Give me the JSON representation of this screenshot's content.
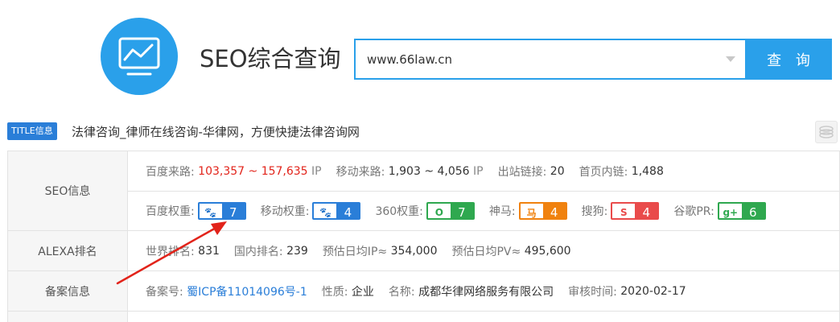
{
  "header": {
    "title": "SEO综合查询",
    "search_value": "www.66law.cn",
    "search_button": "查 询"
  },
  "title_row": {
    "badge": "TITLE信息",
    "text": "法律咨询_律师在线咨询-华律网，方便快捷法律咨询网"
  },
  "seo": {
    "label": "SEO信息",
    "baidu_traffic_label": "百度来路:",
    "baidu_traffic_value": "103,357 ~ 157,635",
    "baidu_traffic_unit": "IP",
    "mobile_traffic_label": "移动来路:",
    "mobile_traffic_value": "1,903 ~ 4,056",
    "mobile_traffic_unit": "IP",
    "outlinks_label": "出站链接:",
    "outlinks_value": "20",
    "inlinks_label": "首页内链:",
    "inlinks_value": "1,488",
    "weights": [
      {
        "label": "百度权重:",
        "icon": "paw-icon",
        "glyph": "🐾",
        "value": "7",
        "color": "#2a7ed8"
      },
      {
        "label": "移动权重:",
        "icon": "paw-icon",
        "glyph": "🐾",
        "value": "4",
        "color": "#2a7ed8"
      },
      {
        "label": "360权重:",
        "icon": "360-icon",
        "glyph": "O",
        "value": "7",
        "color": "#2fa84f"
      },
      {
        "label": "神马:",
        "icon": "shenma-icon",
        "glyph": "马",
        "value": "4",
        "color": "#f0820f"
      },
      {
        "label": "搜狗:",
        "icon": "sogou-icon",
        "glyph": "S",
        "value": "4",
        "color": "#e94b4b"
      },
      {
        "label": "谷歌PR:",
        "icon": "google-plus-icon",
        "glyph": "g+",
        "value": "6",
        "color": "#2fa84f"
      }
    ]
  },
  "alexa": {
    "label": "ALEXA排名",
    "world_label": "世界排名:",
    "world_value": "831",
    "domestic_label": "国内排名:",
    "domestic_value": "239",
    "ip_label": "预估日均IP≈",
    "ip_value": "354,000",
    "pv_label": "预估日均PV≈",
    "pv_value": "495,600"
  },
  "icp": {
    "label": "备案信息",
    "number_label": "备案号:",
    "number_value": "蜀ICP备11014096号-1",
    "nature_label": "性质:",
    "nature_value": "企业",
    "name_label": "名称:",
    "name_value": "成都华律网络服务有限公司",
    "audit_label": "审核时间:",
    "audit_value": "2020-02-17"
  }
}
